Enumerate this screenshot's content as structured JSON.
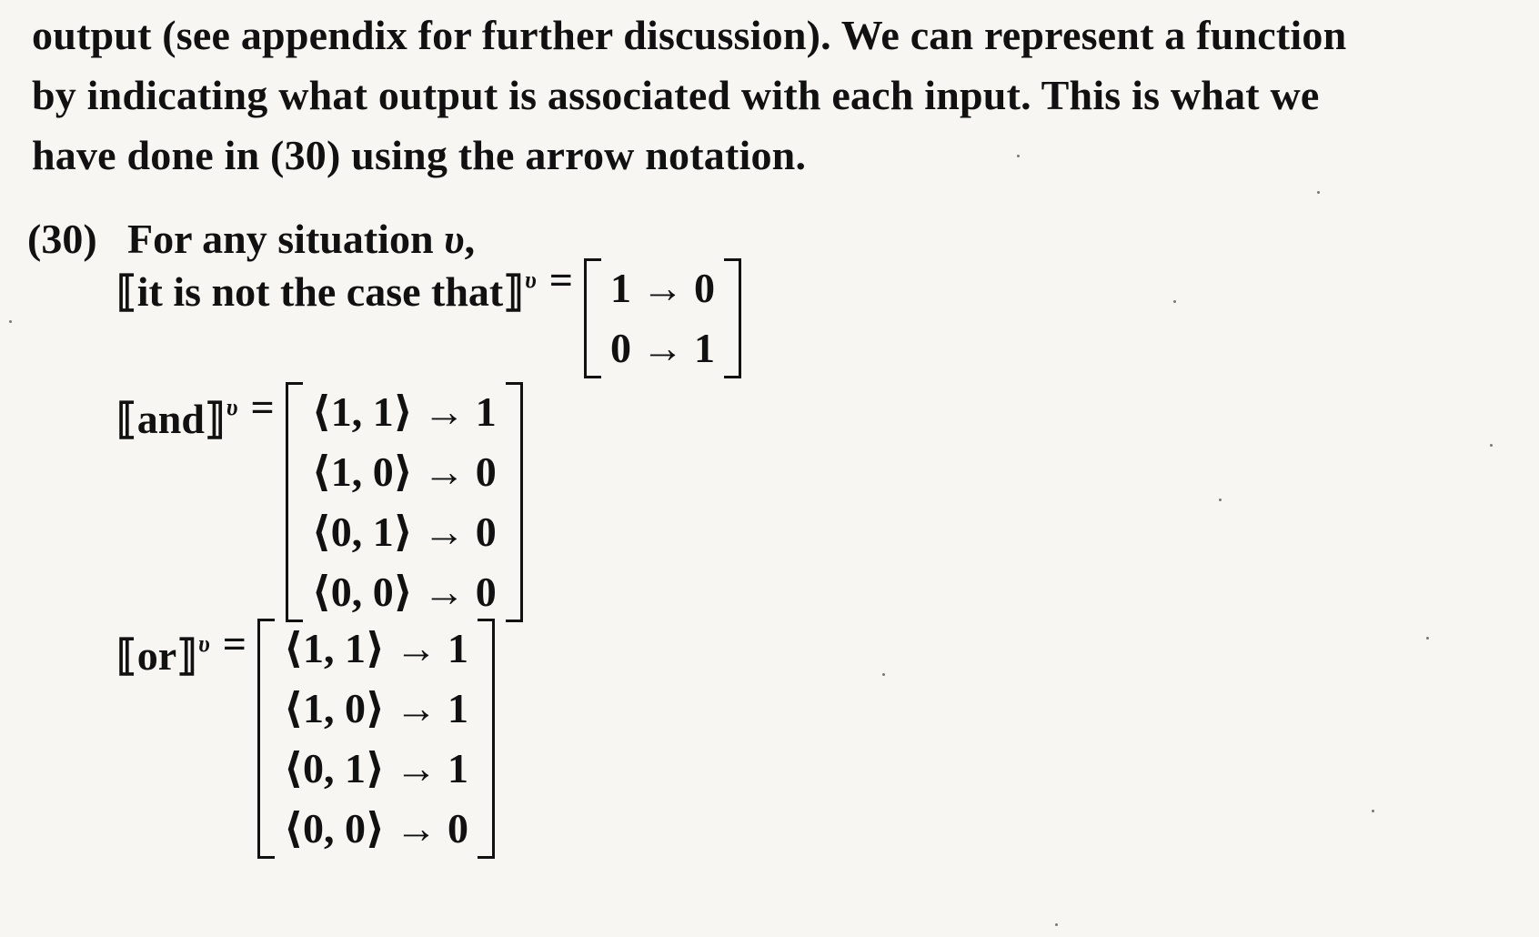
{
  "paragraph": {
    "lines": [
      "output (see appendix for further discussion). We can represent a function",
      "by indicating what output is associated with each input. This is what we",
      "have done in (30) using the arrow notation."
    ]
  },
  "example": {
    "number": "(30)",
    "intro_text": "For any situation ",
    "variable": "υ",
    "intro_suffix": ",",
    "negation": {
      "lhs": "⟦it is not the case that⟧",
      "superscript": "υ",
      "equals": "=",
      "rows": [
        "1 → 0",
        "0 → 1"
      ]
    },
    "and": {
      "lhs": "⟦and⟧",
      "superscript": "υ",
      "equals": "=",
      "rows": [
        "⟨1, 1⟩ → 1",
        "⟨1, 0⟩ → 0",
        "⟨0, 1⟩ → 0",
        "⟨0, 0⟩ → 0"
      ]
    },
    "or": {
      "lhs": "⟦or⟧",
      "superscript": "υ",
      "equals": "=",
      "rows": [
        "⟨1, 1⟩ → 1",
        "⟨1, 0⟩ → 1",
        "⟨0, 1⟩ → 1",
        "⟨0, 0⟩ → 0"
      ]
    }
  }
}
